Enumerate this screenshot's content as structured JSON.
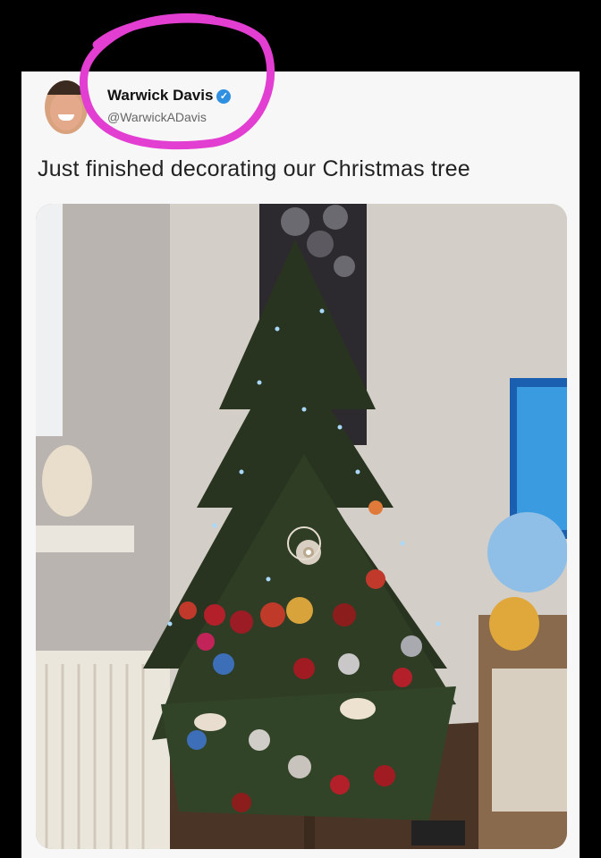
{
  "post": {
    "author_name": "Warwick Davis",
    "verified_mark": "✓",
    "handle": "@WarwickADavis",
    "text": "Just finished decorating our Christmas tree"
  },
  "icons": {
    "verified": "verified-badge-icon",
    "highlight": "pink-circle-annotation"
  },
  "colors": {
    "background": "#000000",
    "card": "#f7f7f7",
    "verified": "#2f8fe0",
    "annotation": "#e23ed1"
  }
}
